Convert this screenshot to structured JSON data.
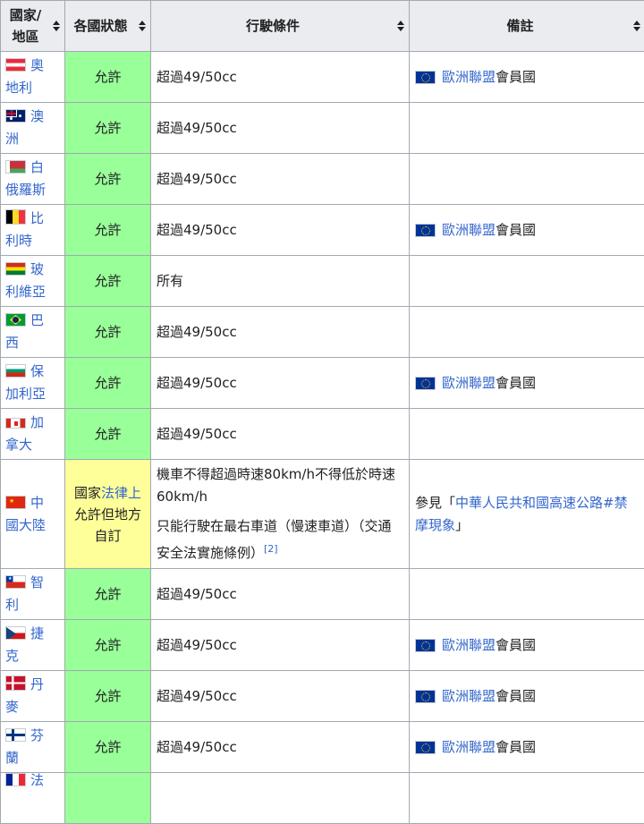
{
  "headers": [
    "國家/地區",
    "各國狀態",
    "行駛條件",
    "備註"
  ],
  "rows": [
    {
      "country_l1": "奧",
      "country_l2": "地利",
      "status": "允許",
      "condition": "超過49/50cc",
      "note_link": "歐洲聯盟",
      "note_text": "會員國",
      "flag": "austria"
    },
    {
      "country_l1": "澳",
      "country_l2": "洲",
      "status": "允許",
      "condition": "超過49/50cc",
      "flag": "australia"
    },
    {
      "country_l1": "白",
      "country_l2": "俄羅斯",
      "status": "允許",
      "condition": "超過49/50cc",
      "flag": "belarus"
    },
    {
      "country_l1": "比",
      "country_l2": "利時",
      "status": "允許",
      "condition": "超過49/50cc",
      "note_link": "歐洲聯盟",
      "note_text": "會員國",
      "flag": "belgium"
    },
    {
      "country_l1": "玻",
      "country_l2": "利維亞",
      "status": "允許",
      "condition": "所有",
      "flag": "bolivia"
    },
    {
      "country_l1": "巴",
      "country_l2": "西",
      "status": "允許",
      "condition": "超過49/50cc",
      "flag": "brazil"
    },
    {
      "country_l1": "保",
      "country_l2": "加利亞",
      "status": "允許",
      "condition": "超過49/50cc",
      "note_link": "歐洲聯盟",
      "note_text": "會員國",
      "flag": "bulgaria"
    },
    {
      "country_l1": "加",
      "country_l2": "拿大",
      "status": "允許",
      "condition": "超過49/50cc",
      "flag": "canada"
    },
    {
      "country_l1": "中",
      "country_l2": "國大陸",
      "status_pre": "國家",
      "status_link": "法律上",
      "status_post": "允許但地方自訂",
      "condition_1": "機車不得超過時速80km/h不得低於時速60km/h",
      "condition_2": "只能行駛在最右車道（慢速車道）（交通安全法實施條例）",
      "condition_ref": "[2]",
      "note_pre": "參見「",
      "note_link": "中華人民共和國高速公路#禁摩現象",
      "note_post": "」",
      "flag": "china"
    },
    {
      "country_l1": "智",
      "country_l2": "利",
      "status": "允許",
      "condition": "超過49/50cc",
      "flag": "chile"
    },
    {
      "country_l1": "捷",
      "country_l2": "克",
      "status": "允許",
      "condition": "超過49/50cc",
      "note_link": "歐洲聯盟",
      "note_text": "會員國",
      "flag": "czech"
    },
    {
      "country_l1": "丹",
      "country_l2": "麥",
      "status": "允許",
      "condition": "超過49/50cc",
      "note_link": "歐洲聯盟",
      "note_text": "會員國",
      "flag": "denmark"
    },
    {
      "country_l1": "芬",
      "country_l2": "蘭",
      "status": "允許",
      "condition": "超過49/50cc",
      "note_link": "歐洲聯盟",
      "note_text": "會員國",
      "flag": "finland"
    },
    {
      "country_l1": "法",
      "flag": "france"
    }
  ]
}
